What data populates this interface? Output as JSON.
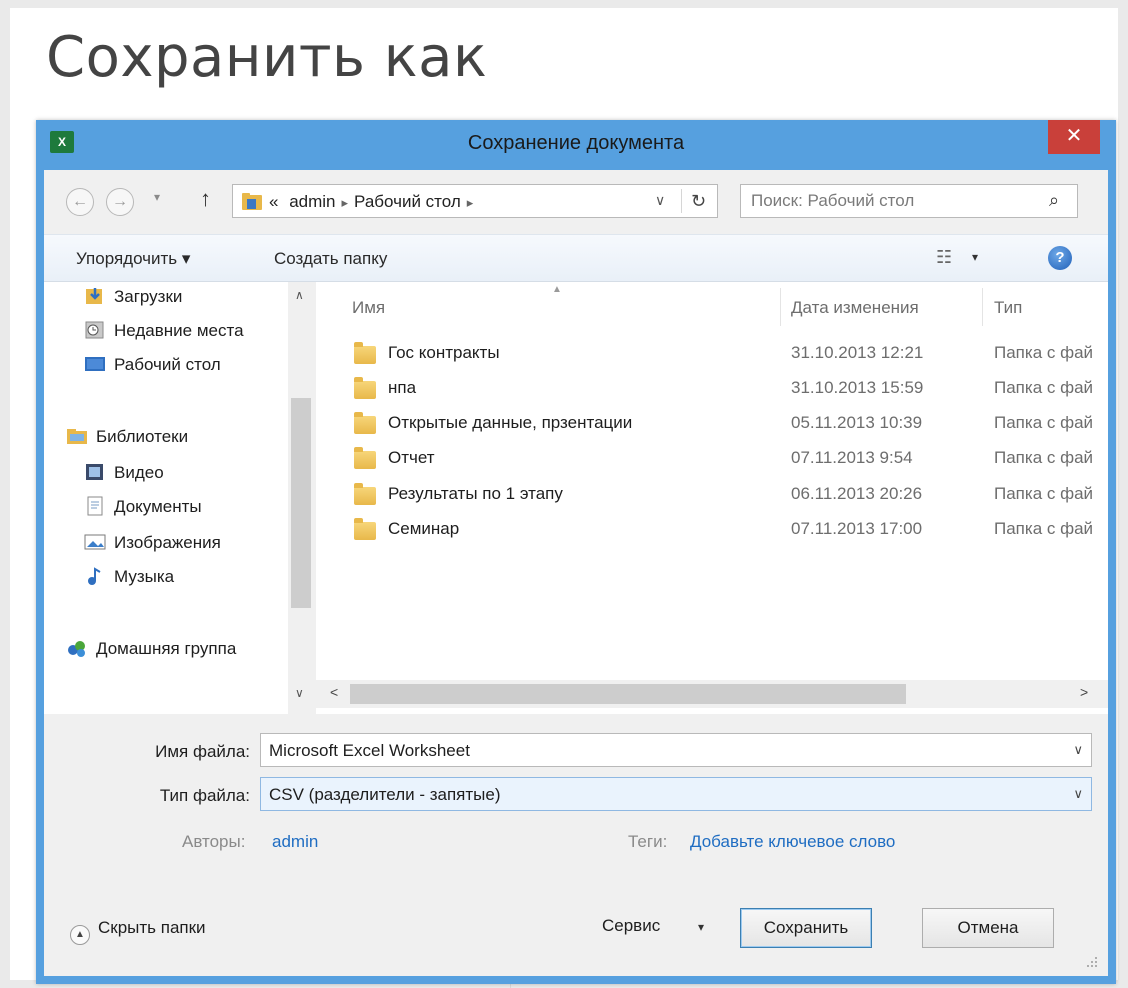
{
  "page": {
    "heading": "Сохранить как"
  },
  "dialog": {
    "title": "Сохранение документа",
    "app_icon_text": "X",
    "close_glyph": "✕",
    "nav": {
      "back_glyph": "←",
      "forward_glyph": "→",
      "history_glyph": "▾",
      "up_glyph": "↑"
    },
    "address": {
      "overflow": "«",
      "segments": [
        "admin",
        "Рабочий стол"
      ],
      "separator": "▸",
      "dropdown_glyph": "∨",
      "refresh_glyph": "↻"
    },
    "search": {
      "placeholder": "Поиск: Рабочий стол",
      "icon_glyph": "⌕"
    },
    "toolbar": {
      "organize": "Упорядочить ▾",
      "new_folder": "Создать папку",
      "view_glyph": "☷",
      "view_drop": "▾",
      "help_glyph": "?"
    },
    "tree": [
      {
        "label": "Загрузки",
        "icon": "downloads-icon"
      },
      {
        "label": "Недавние места",
        "icon": "recent-places-icon"
      },
      {
        "label": "Рабочий стол",
        "icon": "desktop-icon"
      },
      {
        "label": "Библиотеки",
        "icon": "libraries-icon"
      },
      {
        "label": "Видео",
        "icon": "video-icon"
      },
      {
        "label": "Документы",
        "icon": "documents-icon"
      },
      {
        "label": "Изображения",
        "icon": "pictures-icon"
      },
      {
        "label": "Музыка",
        "icon": "music-icon"
      },
      {
        "label": "Домашняя группа",
        "icon": "homegroup-icon"
      }
    ],
    "columns": {
      "name": "Имя",
      "date": "Дата изменения",
      "type": "Тип"
    },
    "files": [
      {
        "name": "Гос контракты",
        "date": "31.10.2013 12:21",
        "type": "Папка с фай"
      },
      {
        "name": "нпа",
        "date": "31.10.2013 15:59",
        "type": "Папка с фай"
      },
      {
        "name": "Открытые данные, прзентации",
        "date": "05.11.2013 10:39",
        "type": "Папка с фай"
      },
      {
        "name": "Отчет",
        "date": "07.11.2013 9:54",
        "type": "Папка с фай"
      },
      {
        "name": "Результаты по 1 этапу",
        "date": "06.11.2013 20:26",
        "type": "Папка с фай"
      },
      {
        "name": "Семинар",
        "date": "07.11.2013 17:00",
        "type": "Папка с фай"
      }
    ],
    "form": {
      "filename_label": "Имя файла:",
      "filename_value": "Microsoft Excel Worksheet",
      "filetype_label": "Тип файла:",
      "filetype_value": "CSV (разделители - запятые)",
      "authors_label": "Авторы:",
      "authors_value": "admin",
      "tags_label": "Теги:",
      "tags_value": "Добавьте ключевое слово",
      "drop_glyph": "∨"
    },
    "bottom": {
      "hide_folders": "Скрыть папки",
      "hide_glyph": "▲",
      "service": "Сервис",
      "service_drop": "▾",
      "save": "Сохранить",
      "cancel": "Отмена"
    },
    "scroll": {
      "up": "∧",
      "down": "∨",
      "left": "<",
      "right": ">"
    },
    "colors": {
      "frame": "#56a0df",
      "close": "#c9403a",
      "link": "#1f6dc2",
      "folder": "#e8b84a"
    }
  }
}
